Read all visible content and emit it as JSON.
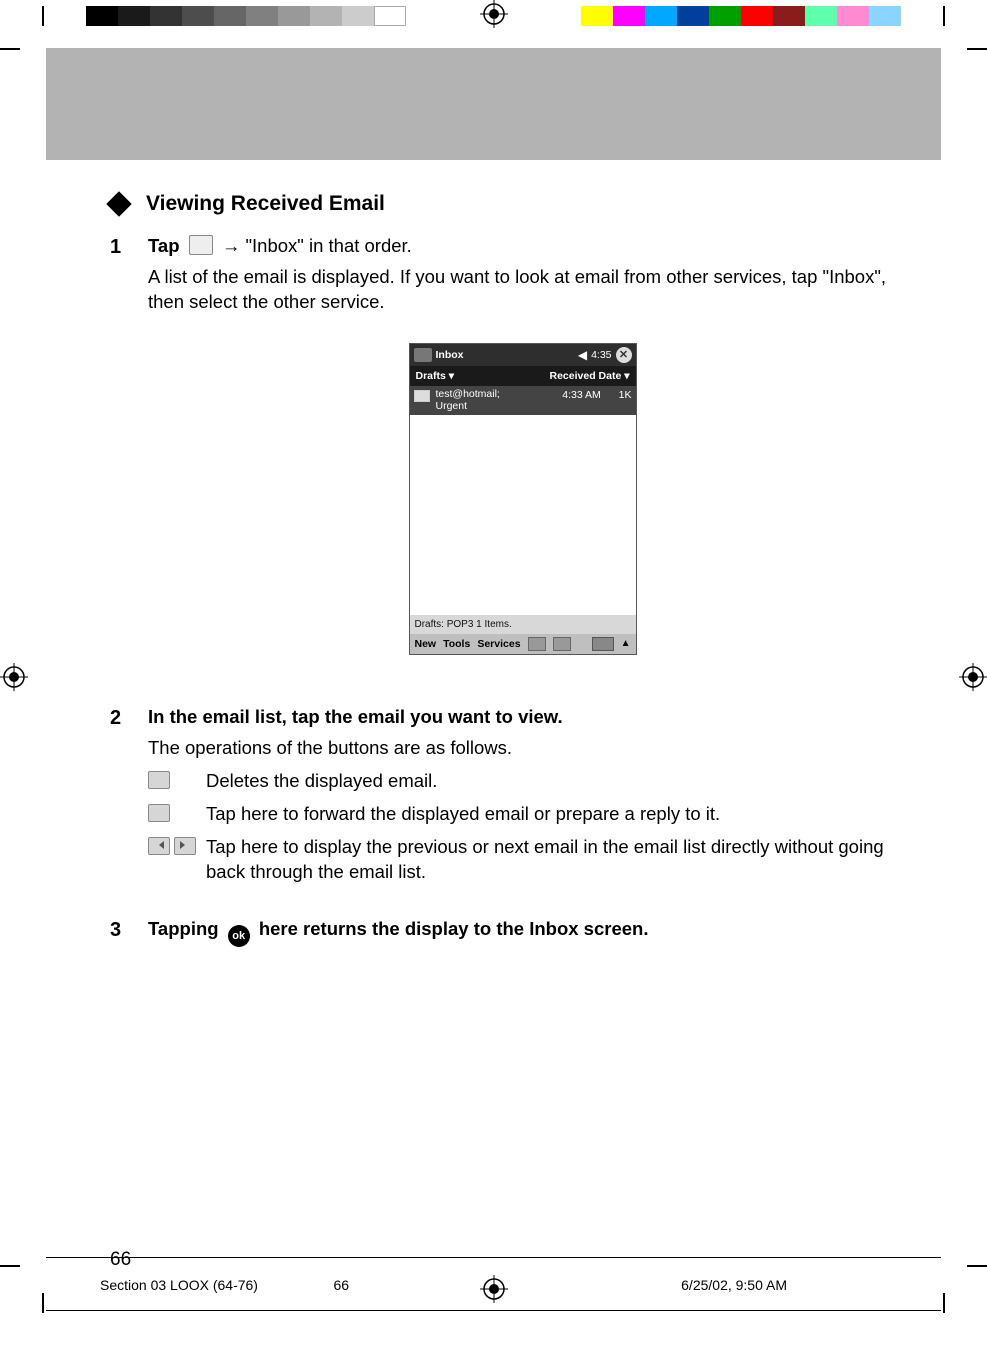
{
  "section_title": "Viewing Received Email",
  "steps": {
    "s1": {
      "num": "1",
      "head_a": "Tap",
      "head_b": "→ \"Inbox\" in that order.",
      "desc": "A list of the email is displayed. If you want to look at email from other services, tap \"Inbox\", then select the other service."
    },
    "s2": {
      "num": "2",
      "head": "In the email list, tap the email you want to view.",
      "desc": "The operations of the buttons are as follows.",
      "btn1": "Deletes the displayed email.",
      "btn2": "Tap here to forward the displayed email or prepare a reply to it.",
      "btn3": "Tap here to display the previous or next email in the email list directly without going back through the email list."
    },
    "s3": {
      "num": "3",
      "head_a": "Tapping",
      "ok_label": "ok",
      "head_b": "here returns the display to the Inbox screen."
    }
  },
  "screenshot": {
    "title": "Inbox",
    "clock": "4:35",
    "sort_left": "Drafts",
    "sort_right": "Received Date",
    "msg_sender": "test@hotmail;",
    "msg_subject": "Urgent",
    "msg_time": "4:33 AM",
    "msg_size": "1K",
    "status": "Drafts: POP3 1 Items.",
    "tb_new": "New",
    "tb_tools": "Tools",
    "tb_services": "Services"
  },
  "page_number": "66",
  "footer": {
    "left": "Section 03 LOOX (64-76)",
    "center": "66",
    "right": "6/25/02, 9:50 AM"
  },
  "icons": {
    "start": "start-icon",
    "delete": "delete-icon",
    "reply": "reply-forward-icon",
    "up": "prev-icon",
    "down": "next-icon"
  },
  "colorbars": {
    "gray": [
      "#000000",
      "#1a1a1a",
      "#333333",
      "#4d4d4d",
      "#666666",
      "#808080",
      "#999999",
      "#b3b3b3",
      "#cccccc",
      "#ffffff"
    ],
    "col": [
      "#ffff00",
      "#ff00ff",
      "#00a9ff",
      "#003f9e",
      "#00a000",
      "#ff0000",
      "#8a1c1c",
      "#5fffae",
      "#ff8ad4",
      "#8ad4ff"
    ]
  }
}
